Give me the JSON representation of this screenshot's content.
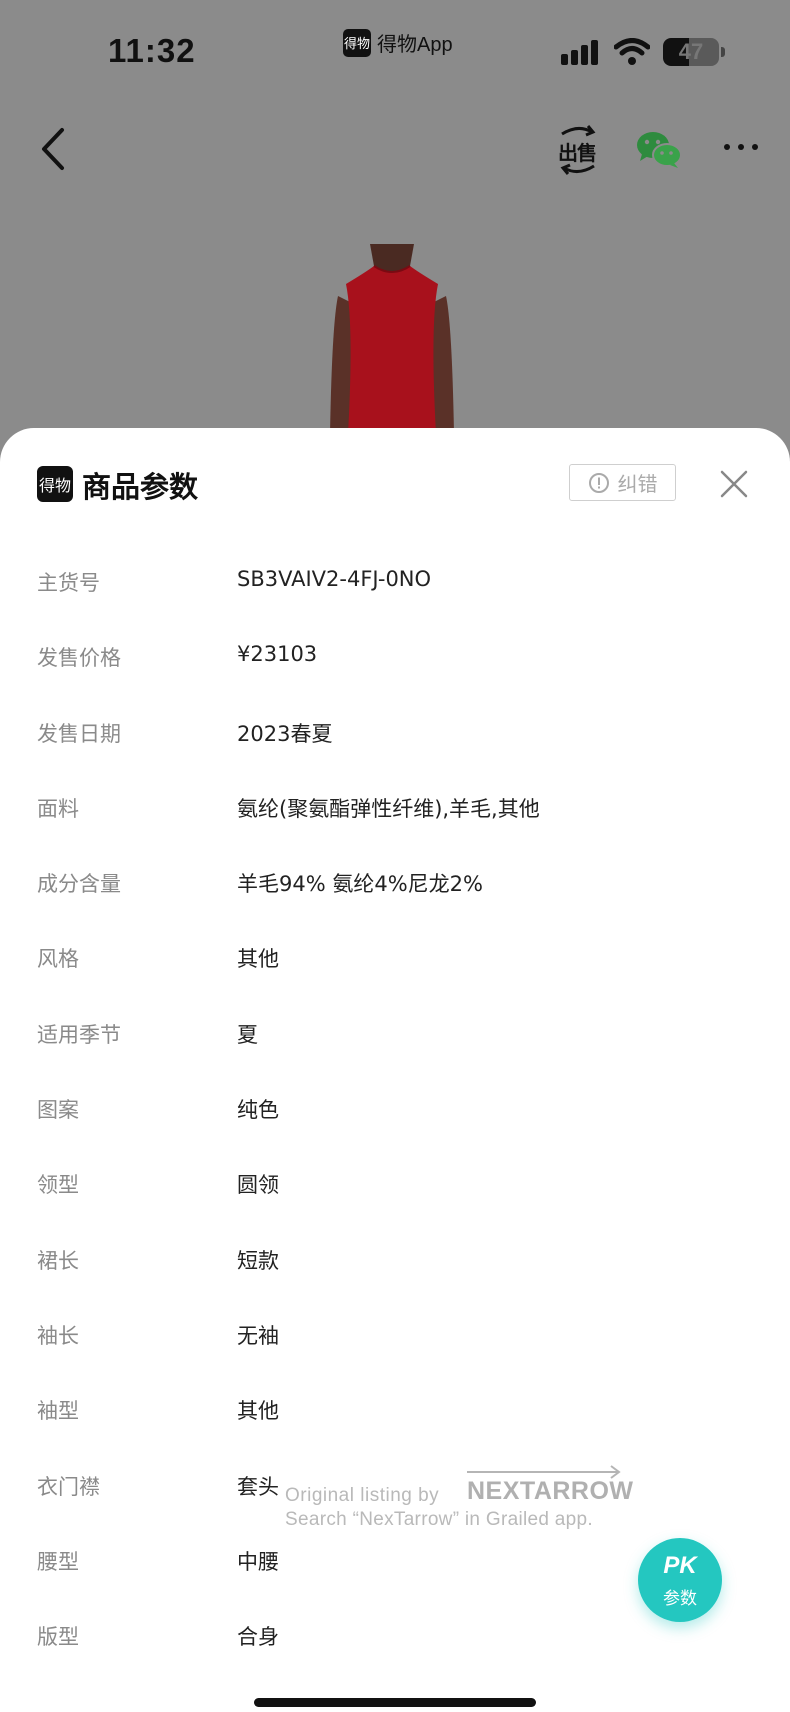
{
  "status_bar": {
    "time": "11:32",
    "app_label": "得物App",
    "app_logo_text": "得物",
    "battery_level": "47",
    "battery_fraction": 0.47,
    "signal_icon": "cellular-signal-icon",
    "wifi_icon": "wifi-icon"
  },
  "nav": {
    "back_icon": "chevron-left-icon",
    "sell_label": "出售",
    "share_icon": "wechat-icon",
    "more_icon": "more-horizontal-icon"
  },
  "sheet": {
    "logo_text": "得物",
    "title": "商品参数",
    "report_label": "纠错",
    "close_icon": "close-icon"
  },
  "params": [
    {
      "label": "主货号",
      "value": "SB3VAIV2-4FJ-0NO"
    },
    {
      "label": "发售价格",
      "value": "¥23103"
    },
    {
      "label": "发售日期",
      "value": "2023春夏"
    },
    {
      "label": "面料",
      "value": "氨纶(聚氨酯弹性纤维),羊毛,其他"
    },
    {
      "label": "成分含量",
      "value": "羊毛94% 氨纶4%尼龙2%"
    },
    {
      "label": "风格",
      "value": "其他"
    },
    {
      "label": "适用季节",
      "value": "夏"
    },
    {
      "label": "图案",
      "value": "纯色"
    },
    {
      "label": "领型",
      "value": "圆领"
    },
    {
      "label": "裙长",
      "value": "短款"
    },
    {
      "label": "袖长",
      "value": "无袖"
    },
    {
      "label": "袖型",
      "value": "其他"
    },
    {
      "label": "衣门襟",
      "value": "套头"
    },
    {
      "label": "腰型",
      "value": "中腰"
    },
    {
      "label": "版型",
      "value": "合身"
    }
  ],
  "watermark": {
    "line1": "Original listing by",
    "brand": "NEXTARROW",
    "line2": "Search “NexTarrow” in Grailed app."
  },
  "pk_button": {
    "title": "PK",
    "subtitle": "参数"
  },
  "colors": {
    "overlay": "#8b8b8b",
    "accent": "#24c7c0",
    "label": "#8a8a8a",
    "value": "#222222",
    "dress": "#b0121d"
  }
}
